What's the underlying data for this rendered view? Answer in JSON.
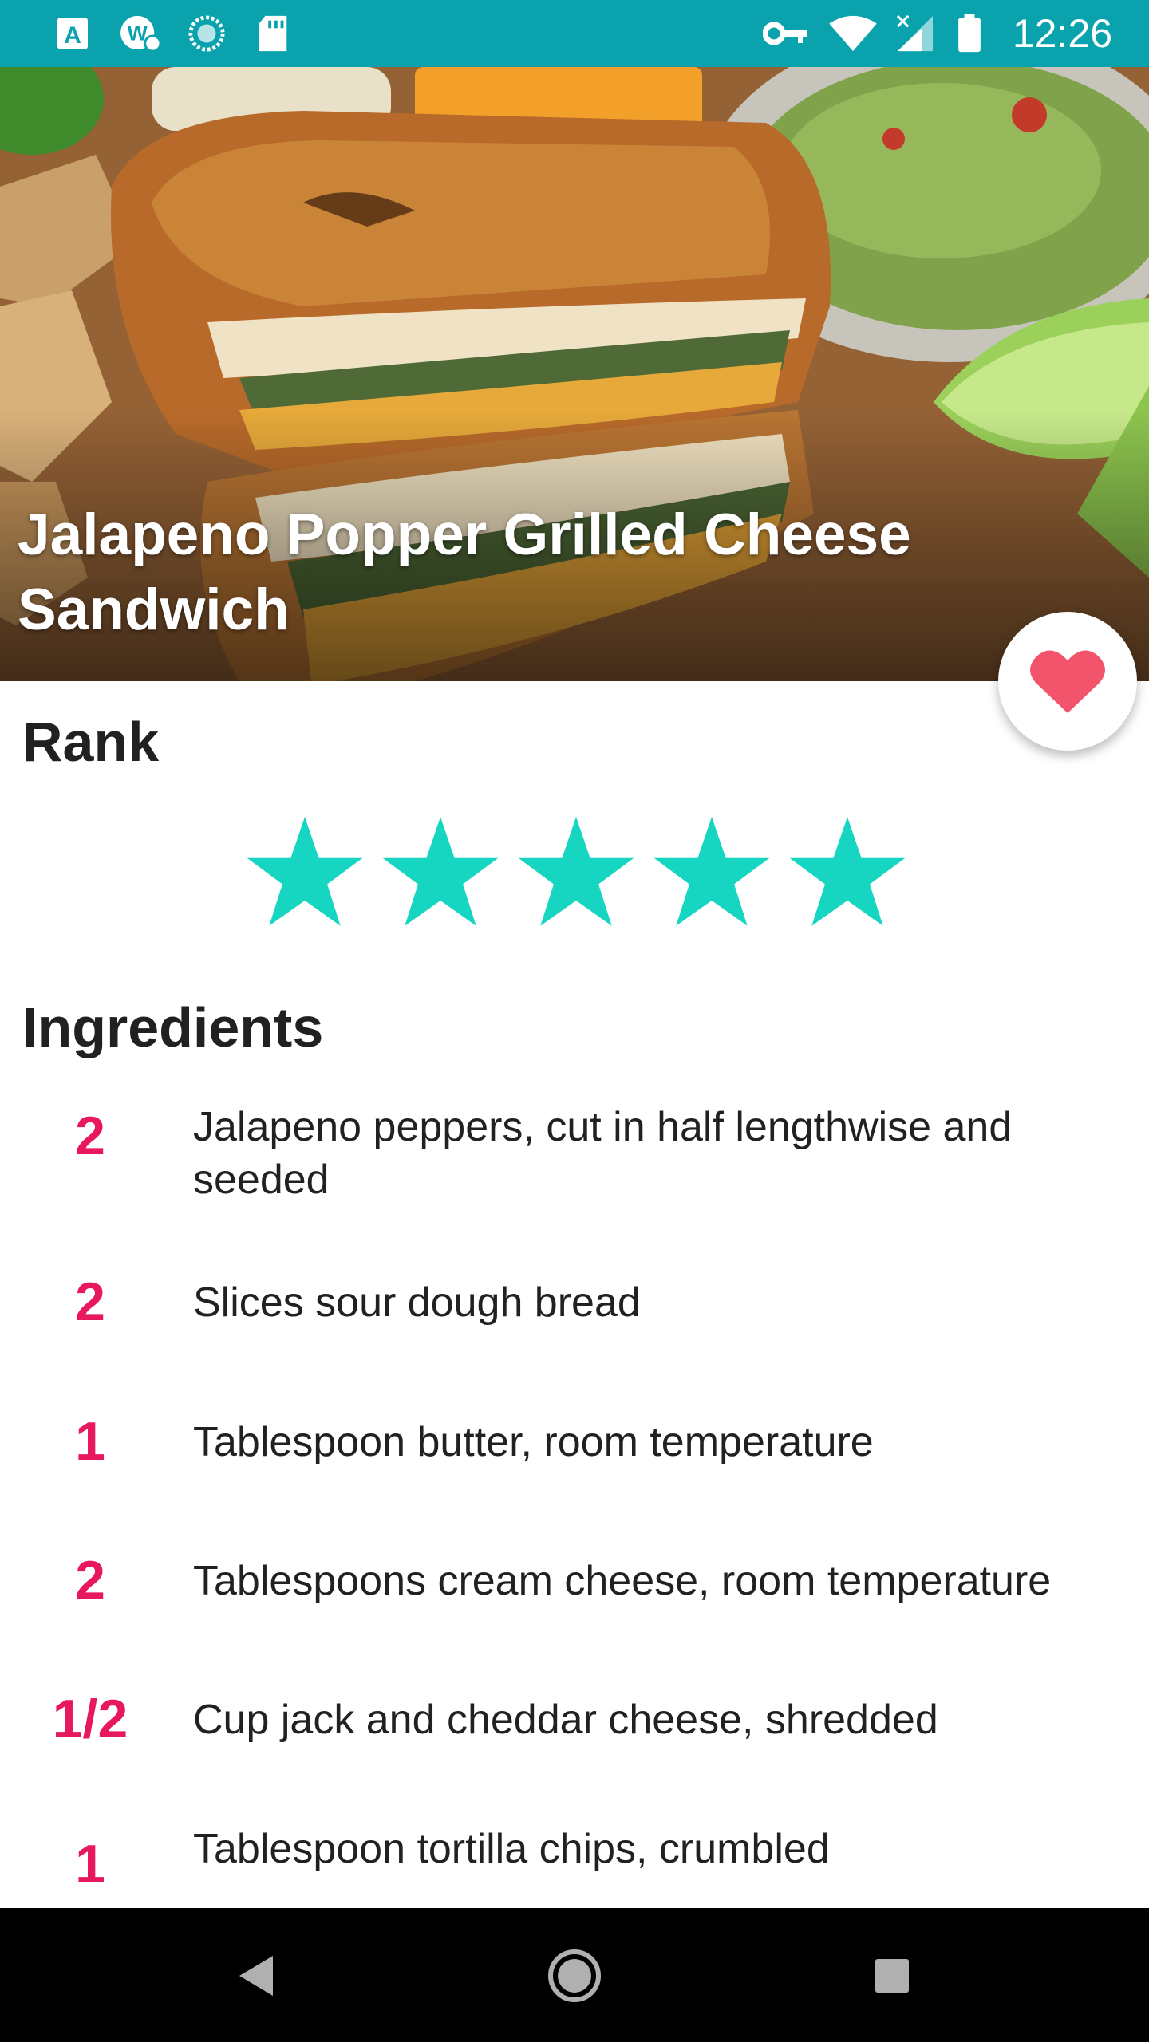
{
  "status_bar": {
    "time": "12:26",
    "left_icons": [
      "app-a-icon",
      "app-w-icon",
      "sync-circle-icon",
      "sd-card-icon"
    ],
    "right_icons": [
      "vpn-key-icon",
      "wifi-icon",
      "signal-icon",
      "battery-icon"
    ]
  },
  "recipe": {
    "title": "Jalapeno Popper Grilled Cheese Sandwich",
    "favorite_icon": "heart-icon",
    "favorite_color": "#f2546b"
  },
  "rank": {
    "title": "Rank",
    "rating": 5,
    "max": 5,
    "star_color": "#16d6c2"
  },
  "ingredients": {
    "title": "Ingredients",
    "qty_color": "#e8185e",
    "items": [
      {
        "qty": "2",
        "text": "Jalapeno peppers, cut in half lengthwise and seeded"
      },
      {
        "qty": "2",
        "text": "Slices sour dough bread"
      },
      {
        "qty": "1",
        "text": "Tablespoon butter, room temperature"
      },
      {
        "qty": "2",
        "text": "Tablespoons cream cheese, room temperature"
      },
      {
        "qty": "1/2",
        "text": "Cup jack and cheddar cheese, shredded"
      },
      {
        "qty": "1",
        "text": "Tablespoon tortilla chips, crumbled"
      }
    ]
  },
  "nav_bar": {
    "icons": [
      "back-icon",
      "home-icon",
      "recents-icon"
    ]
  }
}
